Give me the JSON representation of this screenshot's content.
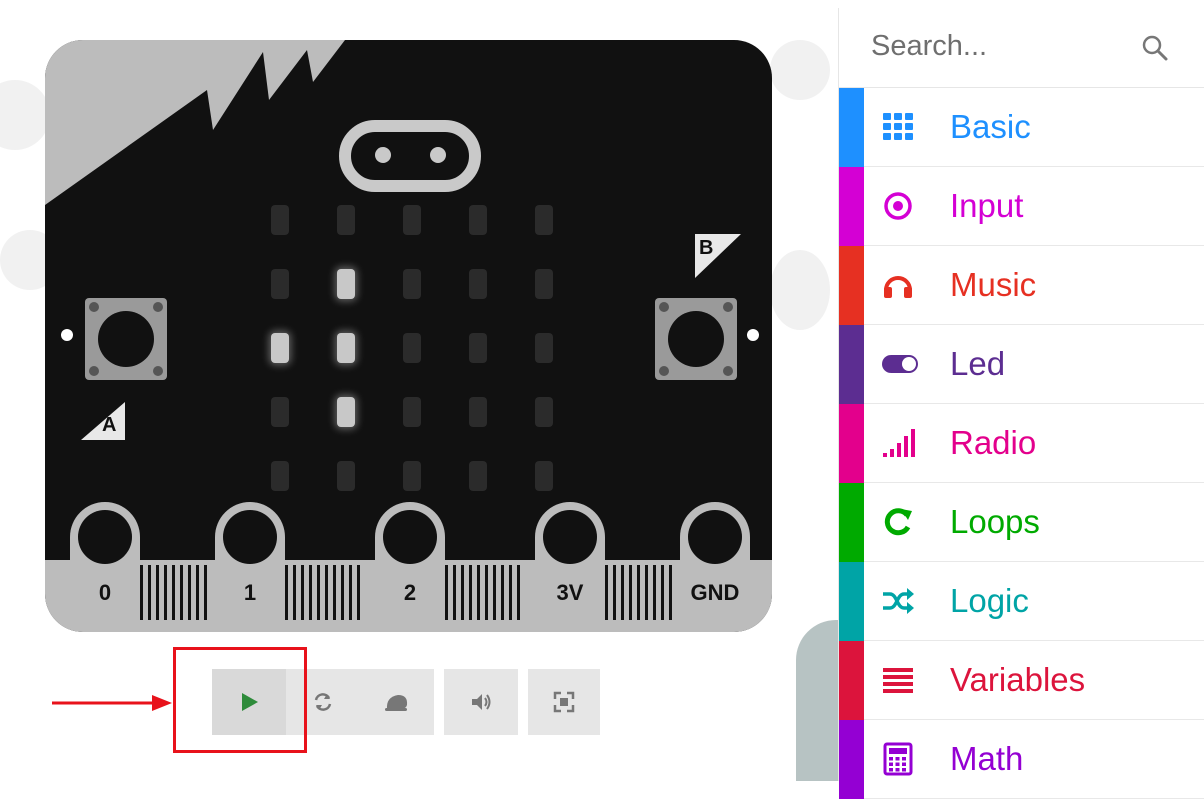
{
  "board": {
    "pins": [
      "0",
      "1",
      "2",
      "3V",
      "GND"
    ],
    "button_a_label": "A",
    "button_b_label": "B",
    "led_matrix": [
      [
        0,
        0,
        0,
        0,
        0
      ],
      [
        0,
        1,
        0,
        0,
        0
      ],
      [
        1,
        1,
        0,
        0,
        0
      ],
      [
        0,
        1,
        0,
        0,
        0
      ],
      [
        0,
        0,
        0,
        0,
        0
      ]
    ]
  },
  "simulator_toolbar": {
    "buttons": [
      "play-icon",
      "restart-icon",
      "slow-mo-icon",
      "mute-icon",
      "fullscreen-icon"
    ]
  },
  "toolbox": {
    "search_placeholder": "Search...",
    "categories": [
      {
        "label": "Basic",
        "color": "#1E90FF",
        "icon": "grid-icon"
      },
      {
        "label": "Input",
        "color": "#D400D4",
        "icon": "target-icon"
      },
      {
        "label": "Music",
        "color": "#E63022",
        "icon": "headphones-icon"
      },
      {
        "label": "Led",
        "color": "#5C2D91",
        "icon": "toggle-icon"
      },
      {
        "label": "Radio",
        "color": "#E3008C",
        "icon": "signal-icon"
      },
      {
        "label": "Loops",
        "color": "#00AA00",
        "icon": "refresh-icon"
      },
      {
        "label": "Logic",
        "color": "#00A4A6",
        "icon": "shuffle-icon"
      },
      {
        "label": "Variables",
        "color": "#DC143C",
        "icon": "list-icon"
      },
      {
        "label": "Math",
        "color": "#9400D3",
        "icon": "calculator-icon"
      }
    ]
  },
  "colors": {
    "board": "#111111",
    "highlight": "#e8121b",
    "play": "#2e8b3a"
  }
}
